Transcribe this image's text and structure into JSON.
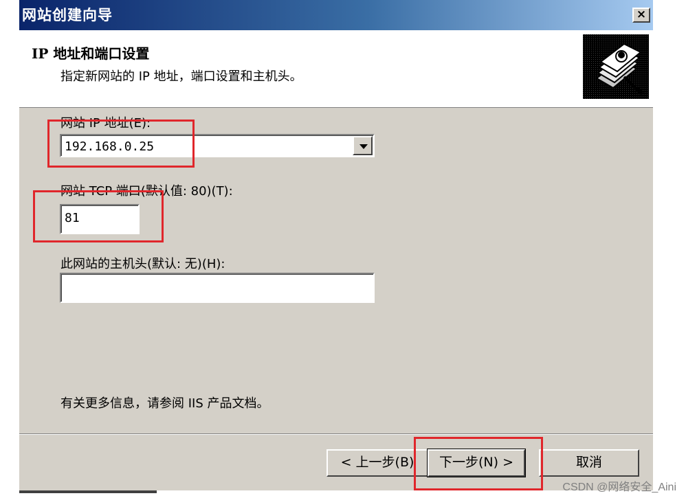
{
  "window": {
    "title": "网站创建向导",
    "close_label": "×"
  },
  "header": {
    "title": "IP 地址和端口设置",
    "subtitle": "指定新网站的 IP 地址，端口设置和主机头。",
    "icon": "wizard-book-icon"
  },
  "form": {
    "ip_label": "网站 IP 地址(E):",
    "ip_value": "192.168.0.25",
    "port_label": "网站 TCP 端口(默认值: 80)(T):",
    "port_value": "81",
    "host_label": "此网站的主机头(默认: 无)(H):",
    "host_value": "",
    "info_text": "有关更多信息，请参阅 IIS 产品文档。"
  },
  "buttons": {
    "back": "< 上一步(B)",
    "next": "下一步(N) >",
    "cancel": "取消"
  },
  "watermark": "CSDN @网络安全_Aini",
  "colors": {
    "highlight": "#e0262b",
    "dialog_bg": "#d4d0c8",
    "title_start": "#0a246a"
  }
}
